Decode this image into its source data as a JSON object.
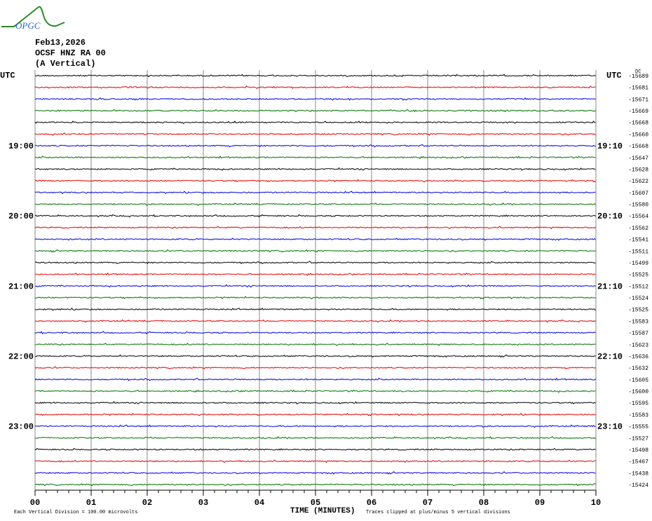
{
  "header": {
    "logo_text": "OPGC",
    "date": "Feb13,2026",
    "station": "OCSF HNZ RA 00",
    "component": "(A Vertical)"
  },
  "chart_data": {
    "type": "line",
    "subtype": "helicorder",
    "xlabel": "TIME (MINUTES)",
    "x_ticks": [
      "00",
      "01",
      "02",
      "03",
      "04",
      "05",
      "06",
      "07",
      "08",
      "09",
      "10"
    ],
    "xlim": [
      0,
      10
    ],
    "left_axis_title": "UTC",
    "right_axis_title": "UTC",
    "dc_label": "DC",
    "left_time_labels": [
      {
        "row": 6,
        "label": "19:00"
      },
      {
        "row": 12,
        "label": "20:00"
      },
      {
        "row": 18,
        "label": "21:00"
      },
      {
        "row": 24,
        "label": "22:00"
      },
      {
        "row": 30,
        "label": "23:00"
      }
    ],
    "right_time_labels": [
      {
        "row": 6,
        "label": "19:10"
      },
      {
        "row": 12,
        "label": "20:10"
      },
      {
        "row": 18,
        "label": "21:10"
      },
      {
        "row": 24,
        "label": "22:10"
      },
      {
        "row": 30,
        "label": "23:10"
      }
    ],
    "dc_offsets": [
      -15689,
      -15681,
      -15671,
      -15669,
      -15668,
      -15660,
      -15668,
      -15647,
      -15628,
      -15622,
      -15607,
      -15580,
      -15564,
      -15562,
      -15541,
      -15511,
      -15499,
      -15525,
      -15512,
      -15524,
      -15525,
      -15583,
      -15587,
      -15623,
      -15636,
      -15632,
      -15605,
      -15600,
      -15595,
      -15583,
      -15555,
      -15527,
      -15498,
      -15467,
      -15438,
      -15424
    ],
    "trace_colors": [
      "#000000",
      "#e00000",
      "#0000e0",
      "#007000"
    ],
    "minutes_per_row": 10,
    "footer_left": "Each Vertical Division =  100.00 microvolts",
    "footer_right": "Traces clipped at plus/minus 5 vertical divisions"
  }
}
